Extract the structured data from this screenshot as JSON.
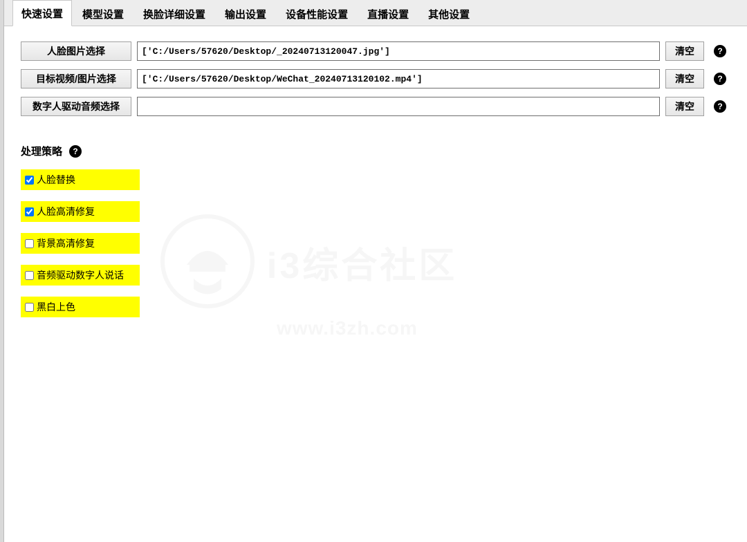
{
  "tabs": [
    {
      "label": "快速设置",
      "active": true
    },
    {
      "label": "模型设置",
      "active": false
    },
    {
      "label": "换脸详细设置",
      "active": false
    },
    {
      "label": "输出设置",
      "active": false
    },
    {
      "label": "设备性能设置",
      "active": false
    },
    {
      "label": "直播设置",
      "active": false
    },
    {
      "label": "其他设置",
      "active": false
    }
  ],
  "rows": {
    "face_image": {
      "button": "人脸图片选择",
      "value": "['C:/Users/57620/Desktop/_20240713120047.jpg']",
      "clear": "清空"
    },
    "target_media": {
      "button": "目标视频/图片选择",
      "value": "['C:/Users/57620/Desktop/WeChat_20240713120102.mp4']",
      "clear": "清空"
    },
    "digital_audio": {
      "button": "数字人驱动音频选择",
      "value": "",
      "clear": "清空"
    }
  },
  "strategy": {
    "title": "处理策略",
    "options": [
      {
        "label": "人脸替换",
        "checked": true
      },
      {
        "label": "人脸高清修复",
        "checked": true
      },
      {
        "label": "背景高清修复",
        "checked": false
      },
      {
        "label": "音频驱动数字人说话",
        "checked": false
      },
      {
        "label": "黑白上色",
        "checked": false
      }
    ]
  },
  "help_glyph": "?",
  "watermark": {
    "title": "i3综合社区",
    "url": "www.i3zh.com"
  }
}
